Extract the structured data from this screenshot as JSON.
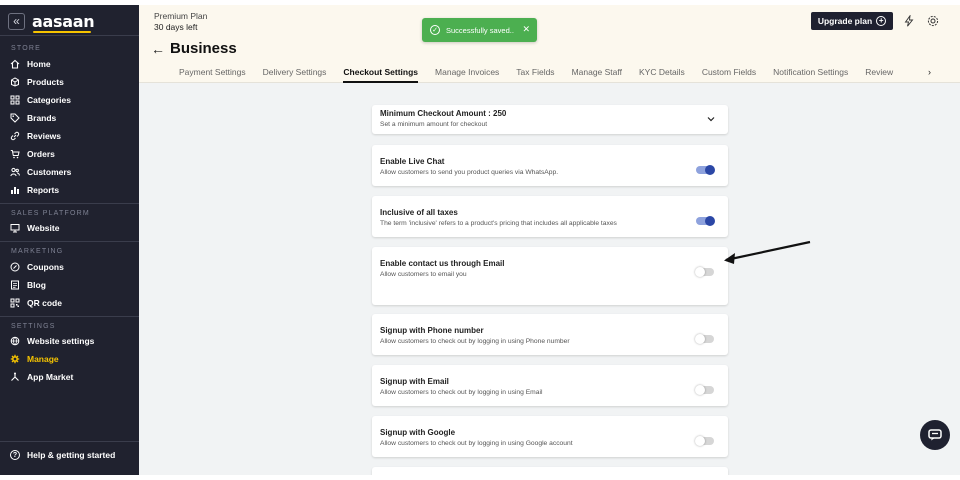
{
  "sidebar": {
    "collapse_icon": "«",
    "logo": "aasaan",
    "sections": [
      {
        "title": "STORE",
        "items": [
          "Home",
          "Products",
          "Categories",
          "Brands",
          "Reviews",
          "Orders",
          "Customers",
          "Reports"
        ]
      },
      {
        "title": "SALES PLATFORM",
        "items": [
          "Website"
        ]
      },
      {
        "title": "MARKETING",
        "items": [
          "Coupons",
          "Blog",
          "QR code"
        ]
      },
      {
        "title": "SETTINGS",
        "items": [
          "Website settings",
          "Manage",
          "App Market"
        ]
      }
    ],
    "active_item": "Manage",
    "help_label": "Help & getting started"
  },
  "header": {
    "plan_name": "Premium Plan",
    "plan_days": "30 days left",
    "page_title": "Business",
    "upgrade_label": "Upgrade plan",
    "tabs": [
      "Payment Settings",
      "Delivery Settings",
      "Checkout Settings",
      "Manage Invoices",
      "Tax Fields",
      "Manage Staff",
      "KYC Details",
      "Custom Fields",
      "Notification Settings",
      "Review"
    ],
    "active_tab": "Checkout Settings"
  },
  "toast": {
    "message": "Successfully saved..",
    "close": "✕"
  },
  "settings": [
    {
      "title": "Minimum Checkout Amount : 250",
      "desc": "Set a minimum amount for checkout",
      "control": "chevron"
    },
    {
      "title": "Enable Live Chat",
      "desc": "Allow customers to send you product queries via WhatsApp.",
      "control": "toggle",
      "on": true
    },
    {
      "title": "Inclusive of all taxes",
      "desc": "The term 'inclusive' refers to a product's pricing that includes all applicable taxes",
      "control": "toggle",
      "on": true
    },
    {
      "title": "Enable contact us through Email",
      "desc": "Allow customers to email you",
      "control": "toggle",
      "on": false
    },
    {
      "title": "Signup with Phone number",
      "desc": "Allow customers to check out by logging in using Phone number",
      "control": "toggle",
      "on": false
    },
    {
      "title": "Signup with Email",
      "desc": "Allow customers to check out by logging in using Email",
      "control": "toggle",
      "on": false
    },
    {
      "title": "Signup with Google",
      "desc": "Allow customers to check out by logging in using Google account",
      "control": "toggle",
      "on": false
    }
  ],
  "colors": {
    "sidebar_bg": "#20222f",
    "accent_yellow": "#f6c400",
    "toggle_on": "#2b47a6",
    "toast_green": "#4caf50"
  }
}
